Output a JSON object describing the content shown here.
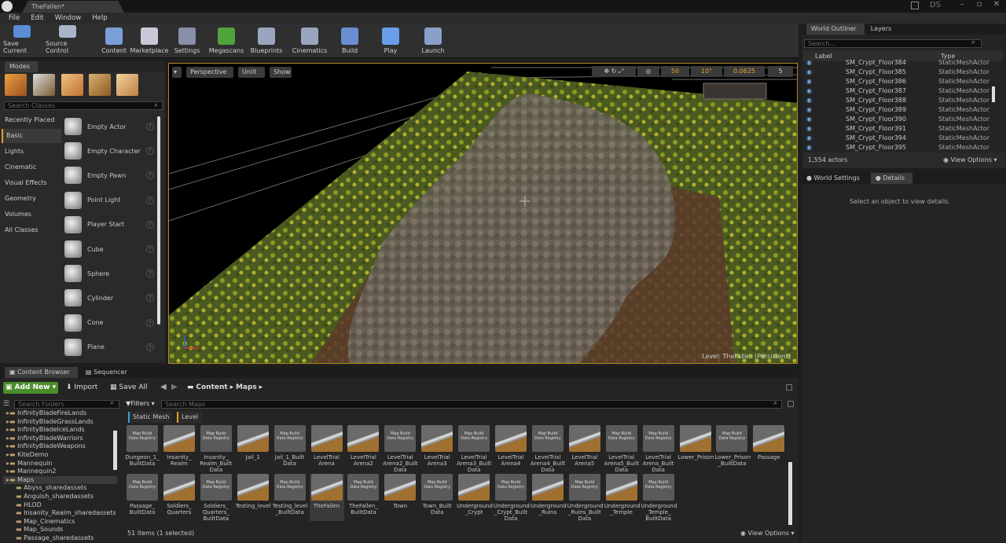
{
  "window": {
    "tab_title": "TheFallen*",
    "user_badge": "DS"
  },
  "menu": [
    "File",
    "Edit",
    "Window",
    "Help"
  ],
  "toolbar": [
    {
      "label": "Save Current",
      "color": "#5a8ed6",
      "icon": "save-icon"
    },
    {
      "label": "Source Control",
      "color": "#aab4c8",
      "icon": "source-control-icon"
    },
    {
      "label": "Content",
      "color": "#7a9fd8",
      "icon": "content-icon"
    },
    {
      "label": "Marketplace",
      "color": "#c8c8d8",
      "icon": "marketplace-icon"
    },
    {
      "label": "Settings",
      "color": "#8890a8",
      "icon": "settings-icon"
    },
    {
      "label": "Megascans",
      "color": "#4fa33a",
      "icon": "megascans-icon"
    },
    {
      "label": "Blueprints",
      "color": "#9aa6c0",
      "icon": "blueprints-icon"
    },
    {
      "label": "Cinematics",
      "color": "#9aa6c0",
      "icon": "cinematics-icon"
    },
    {
      "label": "Build",
      "color": "#6a8ed0",
      "icon": "build-icon"
    },
    {
      "label": "Play",
      "color": "#6a9ee8",
      "icon": "play-icon"
    },
    {
      "label": "Launch",
      "color": "#8aa0c8",
      "icon": "launch-icon"
    }
  ],
  "modes": {
    "title": "Modes",
    "search_placeholder": "Search Classes",
    "categories": [
      "Recently Placed",
      "Basic",
      "Lights",
      "Cinematic",
      "Visual Effects",
      "Geometry",
      "Volumes",
      "All Classes"
    ],
    "selected_category": "Basic",
    "items": [
      "Empty Actor",
      "Empty Character",
      "Empty Pawn",
      "Point Light",
      "Player Start",
      "Cube",
      "Sphere",
      "Cylinder",
      "Cone",
      "Plane"
    ]
  },
  "viewport": {
    "perspective": "Perspective",
    "lit": "Unlit",
    "show": "Show",
    "grid_snap": "50",
    "rotation_snap": "10°",
    "scale_snap": "0.0625",
    "camera_speed": "5",
    "level_label": "Level:  TheFallen (Persistent)"
  },
  "outliner": {
    "tab": "World Outliner",
    "tab2": "Layers",
    "search_placeholder": "Search...",
    "col_label": "Label",
    "col_type": "Type",
    "rows": [
      {
        "label": "SM_Crypt_Floor384",
        "type": "StaticMeshActor"
      },
      {
        "label": "SM_Crypt_Floor385",
        "type": "StaticMeshActor"
      },
      {
        "label": "SM_Crypt_Floor386",
        "type": "StaticMeshActor"
      },
      {
        "label": "SM_Crypt_Floor387",
        "type": "StaticMeshActor"
      },
      {
        "label": "SM_Crypt_Floor388",
        "type": "StaticMeshActor"
      },
      {
        "label": "SM_Crypt_Floor389",
        "type": "StaticMeshActor"
      },
      {
        "label": "SM_Crypt_Floor390",
        "type": "StaticMeshActor"
      },
      {
        "label": "SM_Crypt_Floor391",
        "type": "StaticMeshActor"
      },
      {
        "label": "SM_Crypt_Floor394",
        "type": "StaticMeshActor"
      },
      {
        "label": "SM_Crypt_Floor395",
        "type": "StaticMeshActor"
      }
    ],
    "count": "1,554 actors",
    "view_options": "View Options"
  },
  "details": {
    "tab1": "World Settings",
    "tab2": "Details",
    "empty_text": "Select an object to view details."
  },
  "content_browser": {
    "tab1": "Content Browser",
    "tab2": "Sequencer",
    "add_new": "Add New",
    "import": "Import",
    "save_all": "Save All",
    "path": [
      "Content",
      "Maps"
    ],
    "folder_search": "Search Folders",
    "filters": "Filters",
    "asset_search": "Search Maps",
    "filter_chips": [
      "Static Mesh",
      "Level"
    ],
    "folders": [
      "InfinityBladeFireLands",
      "InfinityBladeGrassLands",
      "InfinityBladeIceLands",
      "InfinityBladeWarriors",
      "InfinityBladeWeapons",
      "KiteDemo",
      "Mannequin",
      "Mannequin2",
      "Maps",
      "Abyss_sharedassets",
      "Anguish_sharedassets",
      "HLOD",
      "Insanity_Realm_sharedassets",
      "Map_Cinematics",
      "Map_Sounds",
      "Passage_sharedassets"
    ],
    "assets_row1": [
      {
        "name": "Dungeon_1_\nBuiltData",
        "kind": "bd"
      },
      {
        "name": "Insanity_\nRealm",
        "kind": "map"
      },
      {
        "name": "Insanity_\nRealm_Built\nData",
        "kind": "bd"
      },
      {
        "name": "Jail_1",
        "kind": "map"
      },
      {
        "name": "Jail_1_Built\nData",
        "kind": "bd"
      },
      {
        "name": "LevelTrial\nArena",
        "kind": "map"
      },
      {
        "name": "LevelTrial\nArena2",
        "kind": "map"
      },
      {
        "name": "LevelTrial\nArena2_Built\nData",
        "kind": "bd"
      },
      {
        "name": "LevelTrial\nArena3",
        "kind": "map"
      },
      {
        "name": "LevelTrial\nArena3_Built\nData",
        "kind": "bd"
      },
      {
        "name": "LevelTrial\nArena4",
        "kind": "map"
      },
      {
        "name": "LevelTrial\nArena4_Built\nData",
        "kind": "bd"
      },
      {
        "name": "LevelTrial\nArena5",
        "kind": "map"
      },
      {
        "name": "LevelTrial\nArena5_Built\nData",
        "kind": "bd"
      },
      {
        "name": "LevelTrial\nArena_Built\nData",
        "kind": "bd"
      },
      {
        "name": "Lower_Prison",
        "kind": "map"
      },
      {
        "name": "Lower_Prison\n_BuiltData",
        "kind": "bd"
      },
      {
        "name": "Passage",
        "kind": "map"
      }
    ],
    "assets_row2": [
      {
        "name": "Passage_\nBuiltData",
        "kind": "bd"
      },
      {
        "name": "Soldiers_\nQuarters",
        "kind": "map"
      },
      {
        "name": "Soldiers_\nQuarters_\nBuiltData",
        "kind": "bd"
      },
      {
        "name": "Testing_level",
        "kind": "map"
      },
      {
        "name": "Testing_level\n_BuiltData",
        "kind": "bd"
      },
      {
        "name": "TheFallen",
        "kind": "map"
      },
      {
        "name": "TheFallen_\nBuiltData",
        "kind": "bd"
      },
      {
        "name": "Town",
        "kind": "map"
      },
      {
        "name": "Town_Built\nData",
        "kind": "bd"
      },
      {
        "name": "Underground\n_Crypt",
        "kind": "map"
      },
      {
        "name": "Underground\n_Crypt_Built\nData",
        "kind": "bd"
      },
      {
        "name": "Underground\n_Ruins",
        "kind": "map"
      },
      {
        "name": "Underground\n_Ruins_Built\nData",
        "kind": "bd"
      },
      {
        "name": "Underground\n_Temple",
        "kind": "map"
      },
      {
        "name": "Underground\n_Temple_\nBuiltData",
        "kind": "bd"
      }
    ],
    "mbdr_label": "Map Build\nData Registry",
    "status": "51 items (1 selected)",
    "view_options": "View Options"
  }
}
